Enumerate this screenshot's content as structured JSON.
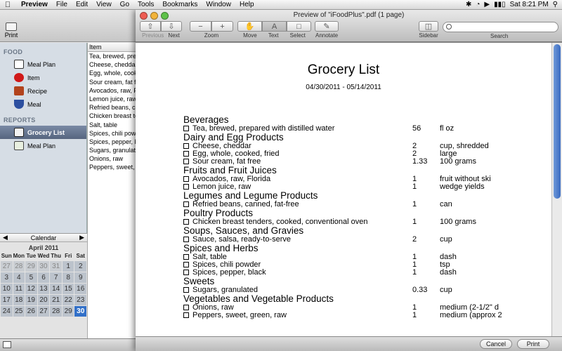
{
  "menubar": {
    "app": "Preview",
    "menus": [
      "File",
      "Edit",
      "View",
      "Go",
      "Tools",
      "Bookmarks",
      "Window",
      "Help"
    ],
    "clock": "Sat 8:21 PM"
  },
  "background_app": {
    "toolbar": {
      "print_label": "Print"
    },
    "sidebar": {
      "food_header": "FOOD",
      "food_items": [
        {
          "label": "Meal Plan",
          "icon": "checklist-icon"
        },
        {
          "label": "Item",
          "icon": "apple-icon"
        },
        {
          "label": "Recipe",
          "icon": "recipe-book-icon"
        },
        {
          "label": "Meal",
          "icon": "bowl-icon"
        }
      ],
      "reports_header": "REPORTS",
      "report_items": [
        {
          "label": "Grocery List",
          "icon": "grocery-report-icon",
          "selected": true
        },
        {
          "label": "Meal Plan",
          "icon": "meal-plan-report-icon",
          "selected": false
        }
      ]
    },
    "item_list": {
      "header": "Item",
      "rows": [
        "Tea, brewed, prepared",
        "Cheese, cheddar",
        "Egg, whole, cooked",
        "Sour cream, fat free",
        "Avocados, raw, Florida",
        "Lemon juice, raw",
        "Refried beans, canned",
        "Chicken breast tenders",
        "Salt, table",
        "Spices, chili powder",
        "Spices, pepper, black",
        "Sugars, granulated",
        "Onions, raw",
        "Peppers, sweet, green"
      ]
    },
    "calendar": {
      "label": "Calendar",
      "month": "April 2011",
      "dow": [
        "Sun",
        "Mon",
        "Tue",
        "Wed",
        "Thu",
        "Fri",
        "Sat"
      ],
      "weeks": [
        [
          "27",
          "28",
          "29",
          "30",
          "31",
          "1",
          "2"
        ],
        [
          "3",
          "4",
          "5",
          "6",
          "7",
          "8",
          "9"
        ],
        [
          "10",
          "11",
          "12",
          "13",
          "14",
          "15",
          "16"
        ],
        [
          "17",
          "18",
          "19",
          "20",
          "21",
          "22",
          "23"
        ],
        [
          "24",
          "25",
          "26",
          "27",
          "28",
          "29",
          "30"
        ]
      ],
      "selected_day": "30"
    }
  },
  "preview": {
    "window_title": "Preview of \"iFoodPlus\".pdf (1 page)",
    "toolbar": {
      "previous": "Previous",
      "next": "Next",
      "zoom": "Zoom",
      "move": "Move",
      "text": "Text",
      "select": "Select",
      "annotate": "Annotate",
      "sidebar": "Sidebar",
      "search": "Search"
    },
    "search_value": "",
    "document": {
      "title": "Grocery List",
      "dates": "04/30/2011 - 05/14/2011",
      "categories": [
        {
          "name": "Beverages",
          "items": [
            {
              "name": "Tea, brewed, prepared with distilled water",
              "qty": "56",
              "unit": "fl oz"
            }
          ]
        },
        {
          "name": "Dairy and Egg Products",
          "items": [
            {
              "name": "Cheese, cheddar",
              "qty": "2",
              "unit": "cup, shredded"
            },
            {
              "name": "Egg, whole, cooked, fried",
              "qty": "2",
              "unit": "large"
            },
            {
              "name": "Sour cream, fat free",
              "qty": "1.33",
              "unit": "100 grams"
            }
          ]
        },
        {
          "name": "Fruits and Fruit Juices",
          "items": [
            {
              "name": "Avocados, raw, Florida",
              "qty": "1",
              "unit": "fruit without ski"
            },
            {
              "name": "Lemon juice, raw",
              "qty": "1",
              "unit": "wedge yields"
            }
          ]
        },
        {
          "name": "Legumes and Legume Products",
          "items": [
            {
              "name": "Refried beans, canned, fat-free",
              "qty": "1",
              "unit": "can"
            }
          ]
        },
        {
          "name": "Poultry Products",
          "items": [
            {
              "name": "Chicken breast tenders, cooked, conventional oven",
              "qty": "1",
              "unit": "100 grams"
            }
          ]
        },
        {
          "name": "Soups, Sauces, and Gravies",
          "items": [
            {
              "name": "Sauce, salsa, ready-to-serve",
              "qty": "2",
              "unit": "cup"
            }
          ]
        },
        {
          "name": "Spices and Herbs",
          "items": [
            {
              "name": "Salt, table",
              "qty": "1",
              "unit": "dash"
            },
            {
              "name": "Spices, chili powder",
              "qty": "1",
              "unit": "tsp"
            },
            {
              "name": "Spices, pepper, black",
              "qty": "1",
              "unit": "dash"
            }
          ]
        },
        {
          "name": "Sweets",
          "items": [
            {
              "name": "Sugars, granulated",
              "qty": "0.33",
              "unit": "cup"
            }
          ]
        },
        {
          "name": "Vegetables and Vegetable Products",
          "items": [
            {
              "name": "Onions, raw",
              "qty": "1",
              "unit": "medium (2-1/2\" d"
            },
            {
              "name": "Peppers, sweet, green, raw",
              "qty": "1",
              "unit": "medium (approx 2"
            }
          ]
        }
      ]
    },
    "buttons": {
      "cancel": "Cancel",
      "print": "Print"
    }
  },
  "colors": {
    "selection": "#3270c8",
    "sidebar_bg": "#d6dde5",
    "sidebar_selected": "#56657f"
  }
}
